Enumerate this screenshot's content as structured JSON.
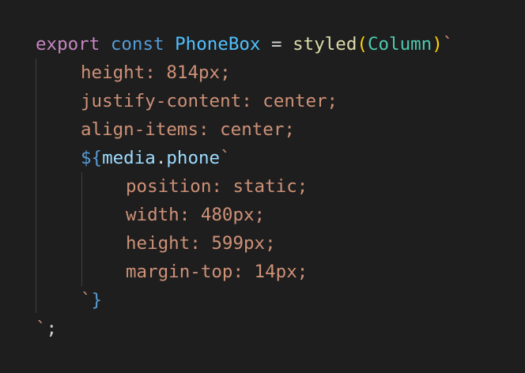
{
  "code": {
    "line1": {
      "export_kw": "export",
      "const_kw": "const",
      "name": "PhoneBox",
      "equals": " = ",
      "fn": "styled",
      "open_paren": "(",
      "arg": "Column",
      "close_paren": ")",
      "backtick": "`"
    },
    "line2": "height: 814px;",
    "line3": "justify-content: center;",
    "line4": "align-items: center;",
    "line5": {
      "interp_open": "${",
      "object": "media",
      "dot": ".",
      "prop": "phone",
      "backtick": "`"
    },
    "line6": "position: static;",
    "line7": "width: 480px;",
    "line8": "height: 599px;",
    "line9": "margin-top: 14px;",
    "line10": {
      "backtick": "`",
      "close_brace": "}"
    },
    "line11": {
      "backtick": "`",
      "semicolon": ";"
    }
  }
}
